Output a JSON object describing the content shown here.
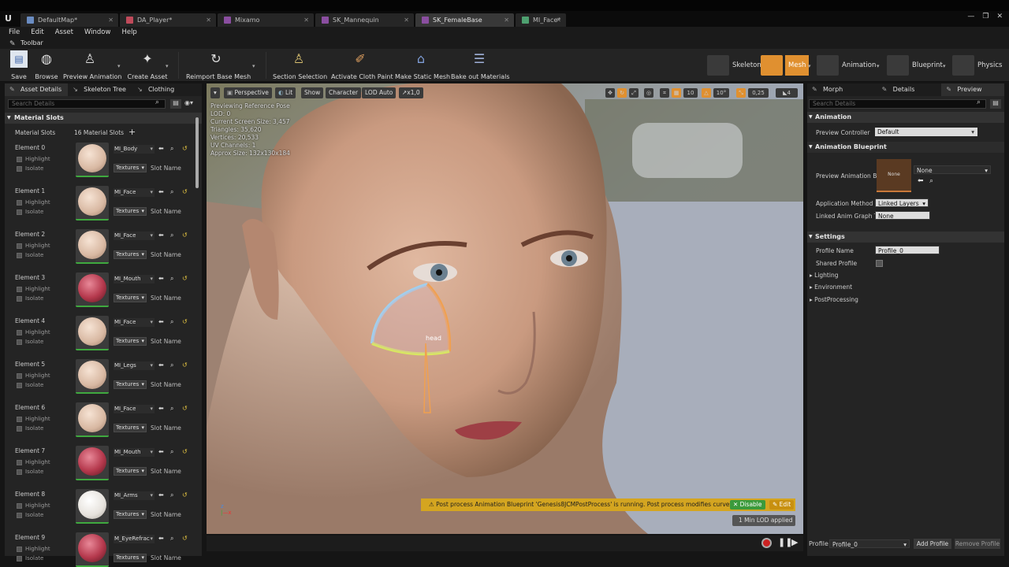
{
  "doc_tabs": [
    {
      "label": "DefaultMap*",
      "color": "#6a8cc2",
      "active": false
    },
    {
      "label": "DA_Player*",
      "color": "#c04a5a",
      "active": false
    },
    {
      "label": "Mixamo",
      "color": "#8a4ea0",
      "active": false
    },
    {
      "label": "SK_Mannequin",
      "color": "#8a4ea0",
      "active": false
    },
    {
      "label": "SK_FemaleBase",
      "color": "#8a4ea0",
      "active": true
    },
    {
      "label": "MI_Face*",
      "color": "#4ea070",
      "active": false
    }
  ],
  "menu": [
    "File",
    "Edit",
    "Asset",
    "Window",
    "Help"
  ],
  "toolbar_label": "Toolbar",
  "toolbar": {
    "save": "Save",
    "browse": "Browse",
    "preview_animation": "Preview Animation",
    "create_asset": "Create Asset",
    "reimport": "Reimport Base Mesh",
    "section_selection": "Section Selection",
    "cloth_paint": "Activate Cloth Paint",
    "make_static": "Make Static Mesh",
    "bake_materials": "Bake out Materials"
  },
  "modes": {
    "skeleton": "Skeleton",
    "mesh": "Mesh",
    "animation": "Animation",
    "blueprint": "Blueprint",
    "physics": "Physics"
  },
  "left_panel": {
    "tabs": [
      "Asset Details",
      "Skeleton Tree",
      "Clothing"
    ],
    "search_placeholder": "Search Details",
    "section": "Material Slots",
    "slots_label": "Material Slots",
    "slots_count": "16 Material Slots",
    "highlight": "Highlight",
    "isolate": "Isolate",
    "textures": "Textures",
    "slot_name": "Slot Name",
    "elements": [
      {
        "name": "Element 0",
        "material": "MI_Body",
        "color": "skin"
      },
      {
        "name": "Element 1",
        "material": "MI_Face",
        "color": "skin"
      },
      {
        "name": "Element 2",
        "material": "MI_Face",
        "color": "skin"
      },
      {
        "name": "Element 3",
        "material": "MI_Mouth",
        "color": "red"
      },
      {
        "name": "Element 4",
        "material": "MI_Face",
        "color": "skin"
      },
      {
        "name": "Element 5",
        "material": "MI_Legs",
        "color": "skin"
      },
      {
        "name": "Element 6",
        "material": "MI_Face",
        "color": "skin"
      },
      {
        "name": "Element 7",
        "material": "MI_Mouth",
        "color": "red"
      },
      {
        "name": "Element 8",
        "material": "MI_Arms",
        "color": "white"
      },
      {
        "name": "Element 9",
        "material": "M_EyeRefrac",
        "color": "red"
      }
    ]
  },
  "viewport": {
    "perspective": "Perspective",
    "lit": "Lit",
    "show": "Show",
    "character": "Character",
    "lod": "LOD Auto",
    "speed": "x1,0",
    "info": [
      "Previewing Reference Pose",
      "LOD: 0",
      "Current Screen Size: 3,457",
      "Triangles: 35,620",
      "Vertices: 20,533",
      "UV Channels: 1",
      "Approx Size: 132x130x184"
    ],
    "grid": "10",
    "angle": "10°",
    "scale": "0,25",
    "cams": "4",
    "bone_label": "head",
    "warning": "Post process Animation Blueprint 'Genesis8JCMPostProcess' is running. Post process modifies curves.",
    "disable": "Disable",
    "edit": "Edit",
    "lod_applied": "1 Min LOD applied"
  },
  "right_panel": {
    "tabs": [
      "Morph Target",
      "Details",
      "Preview Scene"
    ],
    "search_placeholder": "Search Details",
    "animation": "Animation",
    "preview_controller_label": "Preview Controller",
    "preview_controller": "Default",
    "anim_bp_section": "Animation Blueprint",
    "preview_anim_bp_label": "Preview Animation Bl",
    "anim_bp_thumb": "None",
    "anim_bp_value": "None",
    "app_method_label": "Application Method",
    "app_method": "Linked Layers",
    "linked_anim_label": "Linked Anim Graph Ta",
    "linked_anim": "None",
    "settings": "Settings",
    "profile_name_label": "Profile Name",
    "profile_name": "Profile_0",
    "shared_profile_label": "Shared Profile",
    "lighting": "Lighting",
    "environment": "Environment",
    "postprocessing": "PostProcessing",
    "profile_label": "Profile",
    "profile_value": "Profile_0",
    "add_profile": "Add Profile",
    "remove_profile": "Remove Profile"
  },
  "colors": {
    "accent_mesh": "#e09030",
    "warning": "#d4a520",
    "green": "#3fa93f"
  }
}
